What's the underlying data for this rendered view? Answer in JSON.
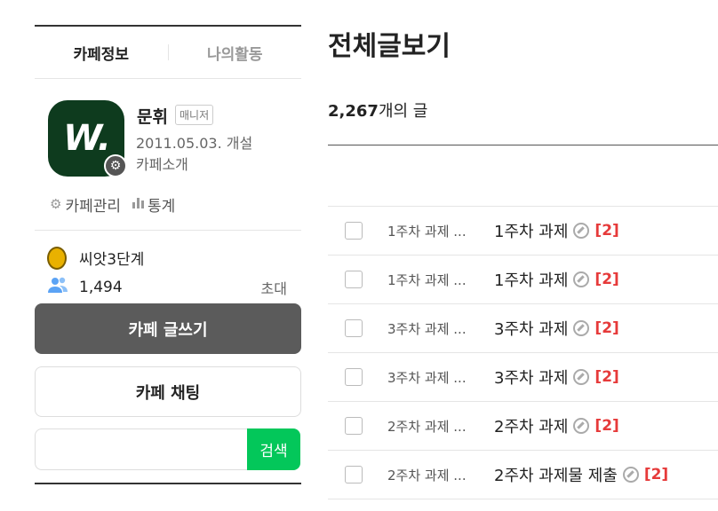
{
  "sidebar": {
    "tabs": [
      {
        "label": "카페정보"
      },
      {
        "label": "나의활동"
      }
    ],
    "profile": {
      "logo_text": "W.",
      "name": "문휘",
      "role": "매니저",
      "founded": "2011.05.03. 개설",
      "intro_link": "카페소개"
    },
    "manage": {
      "label": "카페관리",
      "stats_label": "통계"
    },
    "level": {
      "label": "씨앗3단계"
    },
    "members": {
      "count": "1,494",
      "invite_label": "초대"
    },
    "write_button": "카페 글쓰기",
    "chat_button": "카페 채팅",
    "search": {
      "button": "검색",
      "placeholder": ""
    }
  },
  "main": {
    "title": "전체글보기",
    "count_number": "2,267",
    "count_suffix": "개의 글",
    "posts": [
      {
        "category": "1주차 과제 ...",
        "subject": "1주차 과제",
        "comments": "[2]"
      },
      {
        "category": "1주차 과제 ...",
        "subject": "1주차 과제",
        "comments": "[2]"
      },
      {
        "category": "3주차 과제 ...",
        "subject": "3주차 과제",
        "comments": "[2]"
      },
      {
        "category": "3주차 과제 ...",
        "subject": "3주차 과제",
        "comments": "[2]"
      },
      {
        "category": "2주차 과제 ...",
        "subject": "2주차 과제",
        "comments": "[2]"
      },
      {
        "category": "2주차 과제 ...",
        "subject": "2주차 과제물 제출",
        "comments": "[2]"
      }
    ]
  },
  "colors": {
    "accent": "#03c75a",
    "comment": "#e63a3a",
    "logo_bg": "#0e3b1e",
    "write_button": "#5b5b5b"
  },
  "icons": {
    "manage": "gear-icon",
    "stats": "bar-chart-icon",
    "level": "seed-icon",
    "members": "people-icon",
    "attachment": "link-icon"
  }
}
